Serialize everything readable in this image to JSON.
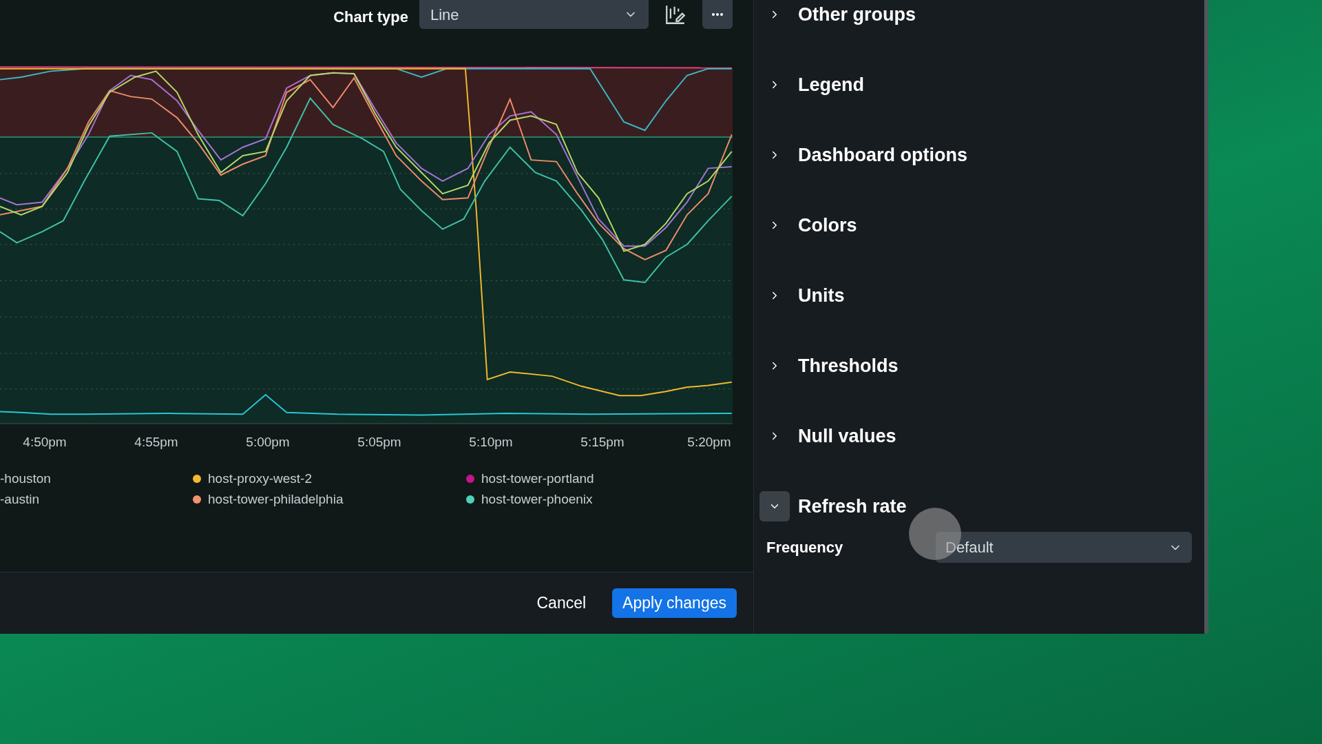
{
  "toolbar": {
    "chart_type_label": "Chart type",
    "chart_type_value": "Line"
  },
  "chart": {
    "x_labels": [
      "4:50pm",
      "4:55pm",
      "5:00pm",
      "5:05pm",
      "5:10pm",
      "5:15pm",
      "5:20pm"
    ]
  },
  "legend": [
    {
      "label": "-houston"
    },
    {
      "label": "-austin"
    },
    {
      "label": "host-proxy-west-2",
      "color": "#f5b82e"
    },
    {
      "label": "host-tower-philadelphia",
      "color": "#f4916e"
    },
    {
      "label": "host-tower-portland",
      "color": "#c2168a"
    },
    {
      "label": "host-tower-phoenix",
      "color": "#4fd1b7"
    }
  ],
  "footer": {
    "cancel": "Cancel",
    "apply": "Apply changes"
  },
  "sidebar": {
    "sections": [
      {
        "label": "Other groups",
        "expanded": false
      },
      {
        "label": "Legend",
        "expanded": false
      },
      {
        "label": "Dashboard options",
        "expanded": false
      },
      {
        "label": "Colors",
        "expanded": false
      },
      {
        "label": "Units",
        "expanded": false
      },
      {
        "label": "Thresholds",
        "expanded": false
      },
      {
        "label": "Null values",
        "expanded": false
      },
      {
        "label": "Refresh rate",
        "expanded": true,
        "field_label": "Frequency",
        "field_value": "Default"
      }
    ]
  }
}
